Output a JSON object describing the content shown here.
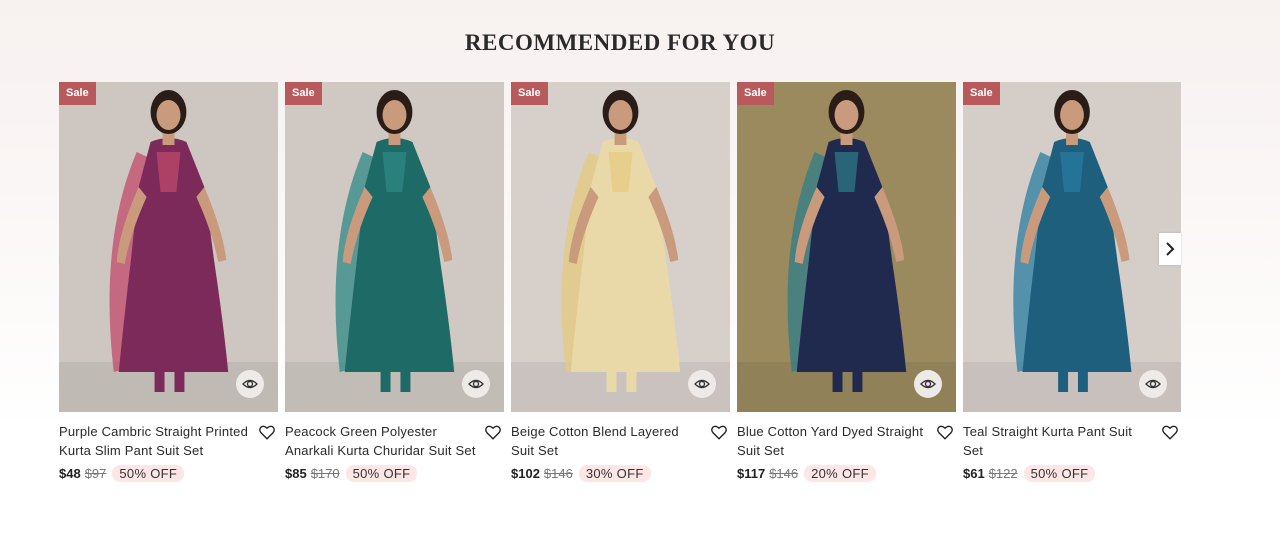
{
  "section": {
    "title": "RECOMMENDED FOR YOU"
  },
  "products": [
    {
      "badge": "Sale",
      "title": "Purple Cambric Straight Printed Kurta Slim Pant Suit Set",
      "price": "$48",
      "compare_price": "$97",
      "discount": "50% OFF",
      "image_alt": "woman in purple kurta with dupatta",
      "colors": {
        "bg": "#cdc6c1",
        "outfit": "#7b2a5a",
        "accent": "#c24a6a"
      }
    },
    {
      "badge": "Sale",
      "title": "Peacock Green Polyester Anarkali Kurta Churidar Suit Set",
      "price": "$85",
      "compare_price": "$170",
      "discount": "50% OFF",
      "image_alt": "woman in peacock green anarkali",
      "colors": {
        "bg": "#cfc8c3",
        "outfit": "#1e6a66",
        "accent": "#2f8a86"
      }
    },
    {
      "badge": "Sale",
      "title": "Beige Cotton Blend Layered Suit Set",
      "price": "$102",
      "compare_price": "$146",
      "discount": "30% OFF",
      "image_alt": "woman in beige layered suit",
      "colors": {
        "bg": "#d6cfca",
        "outfit": "#ead9a8",
        "accent": "#e6c97e"
      }
    },
    {
      "badge": "Sale",
      "title": "Blue Cotton Yard Dyed Straight Suit Set",
      "price": "$117",
      "compare_price": "$146",
      "discount": "20% OFF",
      "image_alt": "woman in navy blue suit set",
      "colors": {
        "bg": "#9b8a5e",
        "outfit": "#1f2a4e",
        "accent": "#2f7d8a"
      }
    },
    {
      "badge": "Sale",
      "title": "Teal Straight Kurta Pant Suit Set",
      "price": "$61",
      "compare_price": "$122",
      "discount": "50% OFF",
      "image_alt": "woman in teal kurta pant set",
      "colors": {
        "bg": "#d4cdc8",
        "outfit": "#1d5f7d",
        "accent": "#2a7ea3"
      }
    }
  ],
  "icons": {
    "quickview": "eye-icon",
    "wishlist": "heart-icon",
    "next": "chevron-right-icon"
  }
}
